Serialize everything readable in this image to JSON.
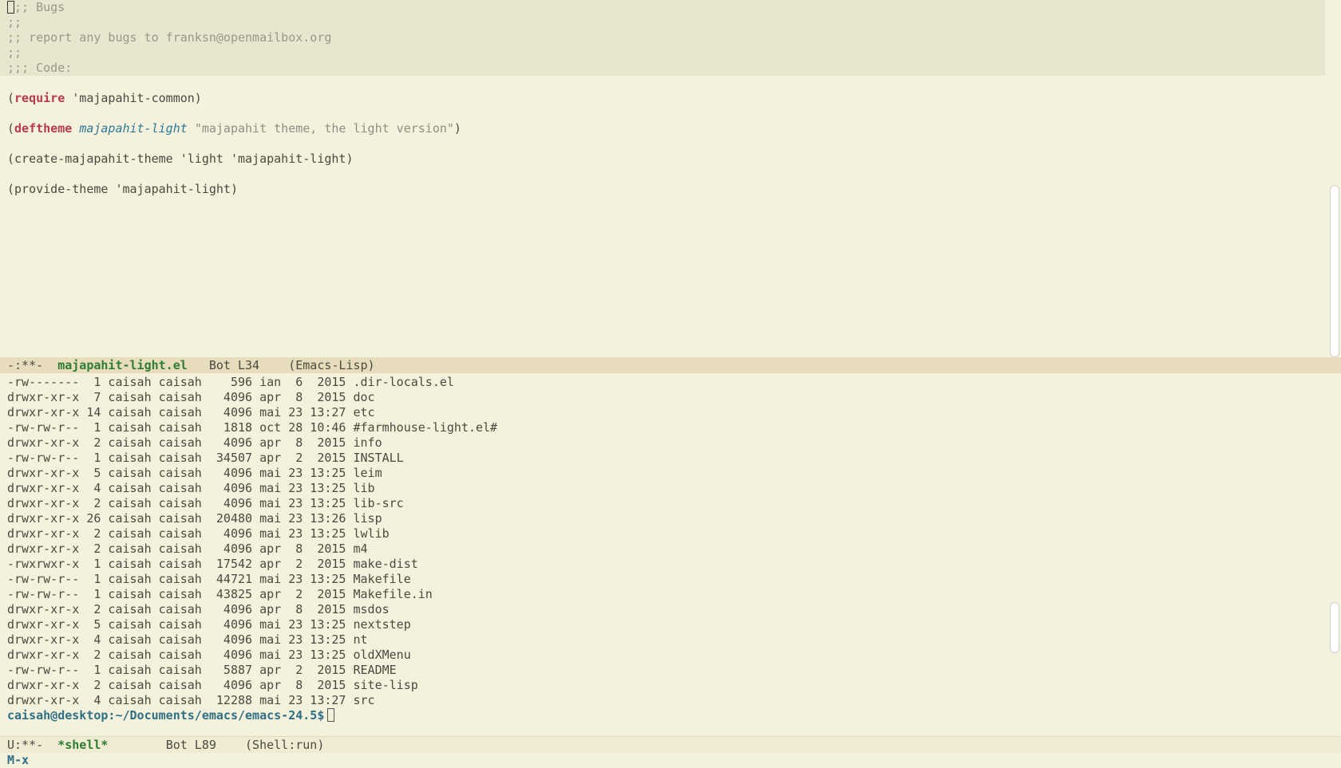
{
  "code_buffer": {
    "comment_lines": [
      ";; Bugs",
      ";;",
      ";; report any bugs to franksn@openmailbox.org",
      ";;",
      ";;; Code:"
    ],
    "forms": {
      "require": {
        "open": "(",
        "keyword": "require",
        "rest": " 'majapahit-common)"
      },
      "deftheme": {
        "open": "(",
        "keyword": "deftheme",
        "name": "majapahit-light",
        "string": "\"majapahit theme, the light version\"",
        "close": ")"
      },
      "create": "(create-majapahit-theme 'light 'majapahit-light)",
      "provide": "(provide-theme 'majapahit-light)"
    }
  },
  "modeline_top": {
    "status": "-:**-",
    "buffer_name": "majapahit-light.el",
    "position": "Bot L34",
    "mode": "(Emacs-Lisp)"
  },
  "shell_listing": [
    "-rw-------  1 caisah caisah    596 ian  6  2015 .dir-locals.el",
    "drwxr-xr-x  7 caisah caisah   4096 apr  8  2015 doc",
    "drwxr-xr-x 14 caisah caisah   4096 mai 23 13:27 etc",
    "-rw-rw-r--  1 caisah caisah   1818 oct 28 10:46 #farmhouse-light.el#",
    "drwxr-xr-x  2 caisah caisah   4096 apr  8  2015 info",
    "-rw-rw-r--  1 caisah caisah  34507 apr  2  2015 INSTALL",
    "drwxr-xr-x  5 caisah caisah   4096 mai 23 13:25 leim",
    "drwxr-xr-x  4 caisah caisah   4096 mai 23 13:25 lib",
    "drwxr-xr-x  2 caisah caisah   4096 mai 23 13:25 lib-src",
    "drwxr-xr-x 26 caisah caisah  20480 mai 23 13:26 lisp",
    "drwxr-xr-x  2 caisah caisah   4096 mai 23 13:25 lwlib",
    "drwxr-xr-x  2 caisah caisah   4096 apr  8  2015 m4",
    "-rwxrwxr-x  1 caisah caisah  17542 apr  2  2015 make-dist",
    "-rw-rw-r--  1 caisah caisah  44721 mai 23 13:25 Makefile",
    "-rw-rw-r--  1 caisah caisah  43825 apr  2  2015 Makefile.in",
    "drwxr-xr-x  2 caisah caisah   4096 apr  8  2015 msdos",
    "drwxr-xr-x  5 caisah caisah   4096 mai 23 13:25 nextstep",
    "drwxr-xr-x  4 caisah caisah   4096 mai 23 13:25 nt",
    "drwxr-xr-x  2 caisah caisah   4096 mai 23 13:25 oldXMenu",
    "-rw-rw-r--  1 caisah caisah   5887 apr  2  2015 README",
    "drwxr-xr-x  2 caisah caisah   4096 apr  8  2015 site-lisp",
    "drwxr-xr-x  4 caisah caisah  12288 mai 23 13:27 src"
  ],
  "shell_prompt": "caisah@desktop:~/Documents/emacs/emacs-24.5$",
  "modeline_bottom": {
    "status": "U:**-",
    "buffer_name": "*shell*",
    "position": "Bot L89",
    "mode": "(Shell:run)"
  },
  "minibuffer": "M-x",
  "colors": {
    "background": "#f4f2dc",
    "keyword": "#b83a4e",
    "function_name": "#2b7a99",
    "buffer_name": "#2e7d32",
    "prompt": "#2f6f86"
  }
}
